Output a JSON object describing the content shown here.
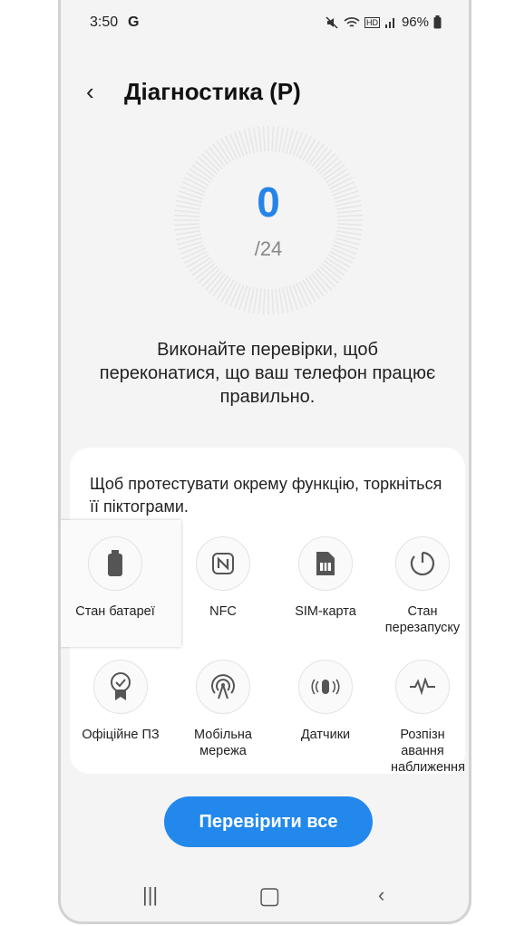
{
  "status": {
    "time": "3:50",
    "g": "G",
    "hd": "HD",
    "battery_pct": "96%"
  },
  "header": {
    "title": "Діагностика (P)"
  },
  "progress": {
    "done": "0",
    "total": "/24"
  },
  "description": "Виконайте перевірки, щоб переконатися, що ваш телефон працює правильно.",
  "hint": "Щоб протестувати окрему функцію, торкніться її піктограми.",
  "tests": [
    {
      "label": "Стан батареї",
      "icon": "battery-icon"
    },
    {
      "label": "NFC",
      "icon": "nfc-icon"
    },
    {
      "label": "SIM-карта",
      "icon": "sim-card-icon"
    },
    {
      "label": "Стан перезапуску",
      "icon": "restart-icon"
    },
    {
      "label": "Офіційне ПЗ",
      "icon": "certified-badge-icon"
    },
    {
      "label": "Мобільна мережа",
      "icon": "cell-tower-icon"
    },
    {
      "label": "Датчики",
      "icon": "sensor-icon"
    },
    {
      "label": "Розпізн авання наближення",
      "icon": "proximity-icon"
    }
  ],
  "button": {
    "check_all": "Перевірити все"
  },
  "colors": {
    "accent": "#2388ec",
    "score": "#2684e8"
  }
}
